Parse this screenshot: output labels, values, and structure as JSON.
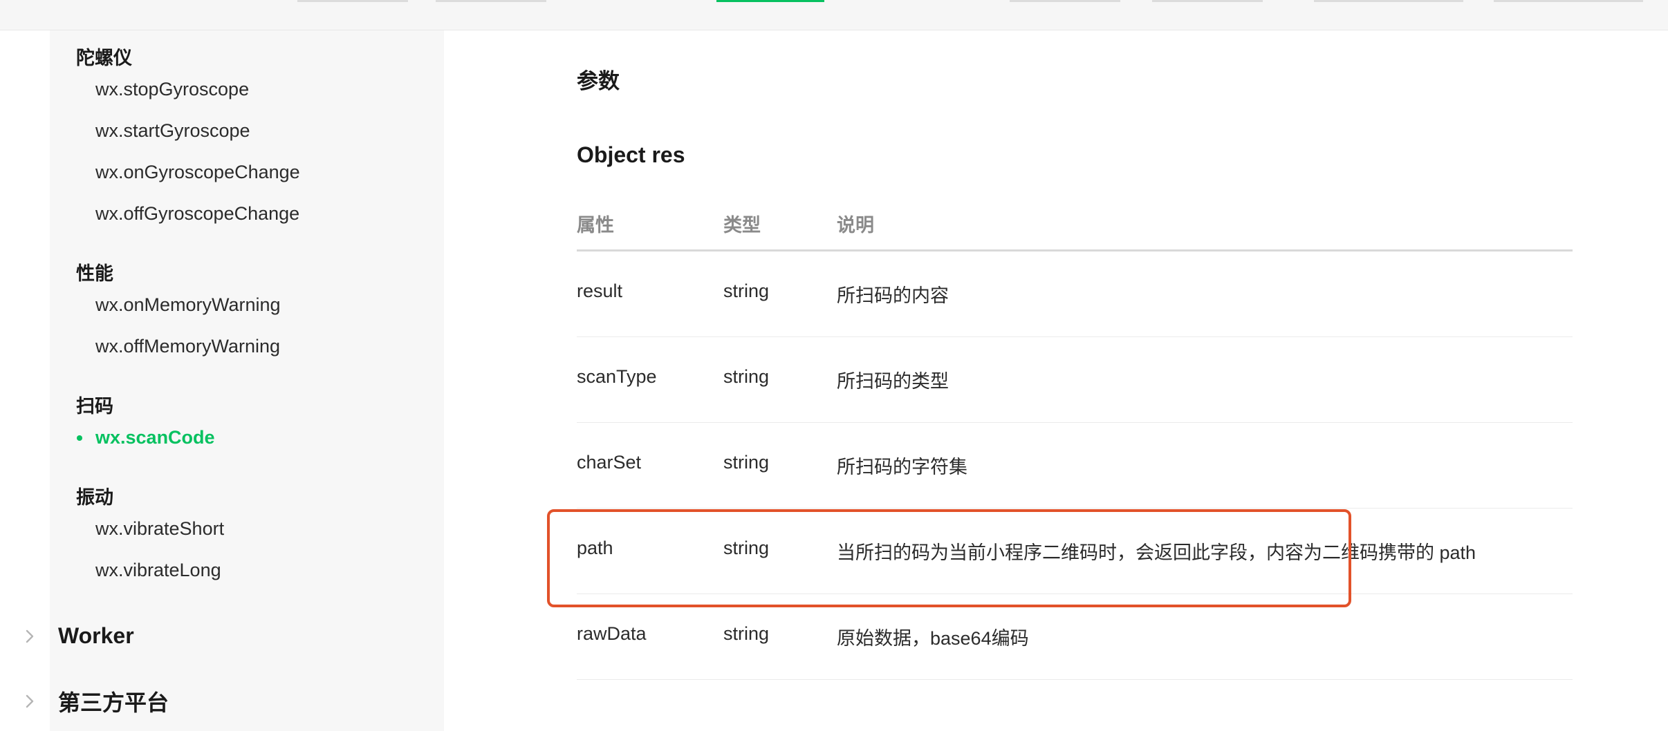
{
  "sidebar": {
    "groups": [
      {
        "title": "陀螺仪",
        "items": [
          "wx.stopGyroscope",
          "wx.startGyroscope",
          "wx.onGyroscopeChange",
          "wx.offGyroscopeChange"
        ]
      },
      {
        "title": "性能",
        "items": [
          "wx.onMemoryWarning",
          "wx.offMemoryWarning"
        ]
      },
      {
        "title": "扫码",
        "items": [
          "wx.scanCode"
        ]
      },
      {
        "title": "振动",
        "items": [
          "wx.vibrateShort",
          "wx.vibrateLong"
        ]
      }
    ],
    "active_item": "wx.scanCode",
    "sections": [
      "Worker",
      "第三方平台"
    ]
  },
  "main": {
    "heading": "参数",
    "subheading": "Object res",
    "table": {
      "columns": [
        "属性",
        "类型",
        "说明"
      ],
      "rows": [
        [
          "result",
          "string",
          "所扫码的内容"
        ],
        [
          "scanType",
          "string",
          "所扫码的类型"
        ],
        [
          "charSet",
          "string",
          "所扫码的字符集"
        ],
        [
          "path",
          "string",
          "当所扫的码为当前小程序二维码时，会返回此字段，内容为二维码携带的 path"
        ],
        [
          "rawData",
          "string",
          "原始数据，base64编码"
        ]
      ],
      "highlighted_row": "path"
    }
  },
  "colors": {
    "accent": "#07c160",
    "highlight_border": "#e2522a",
    "sidebar_bg": "#f7f7f7",
    "header_text": "#8a8a8a"
  },
  "icons": {
    "section_toggle": "chevron-right-icon"
  }
}
